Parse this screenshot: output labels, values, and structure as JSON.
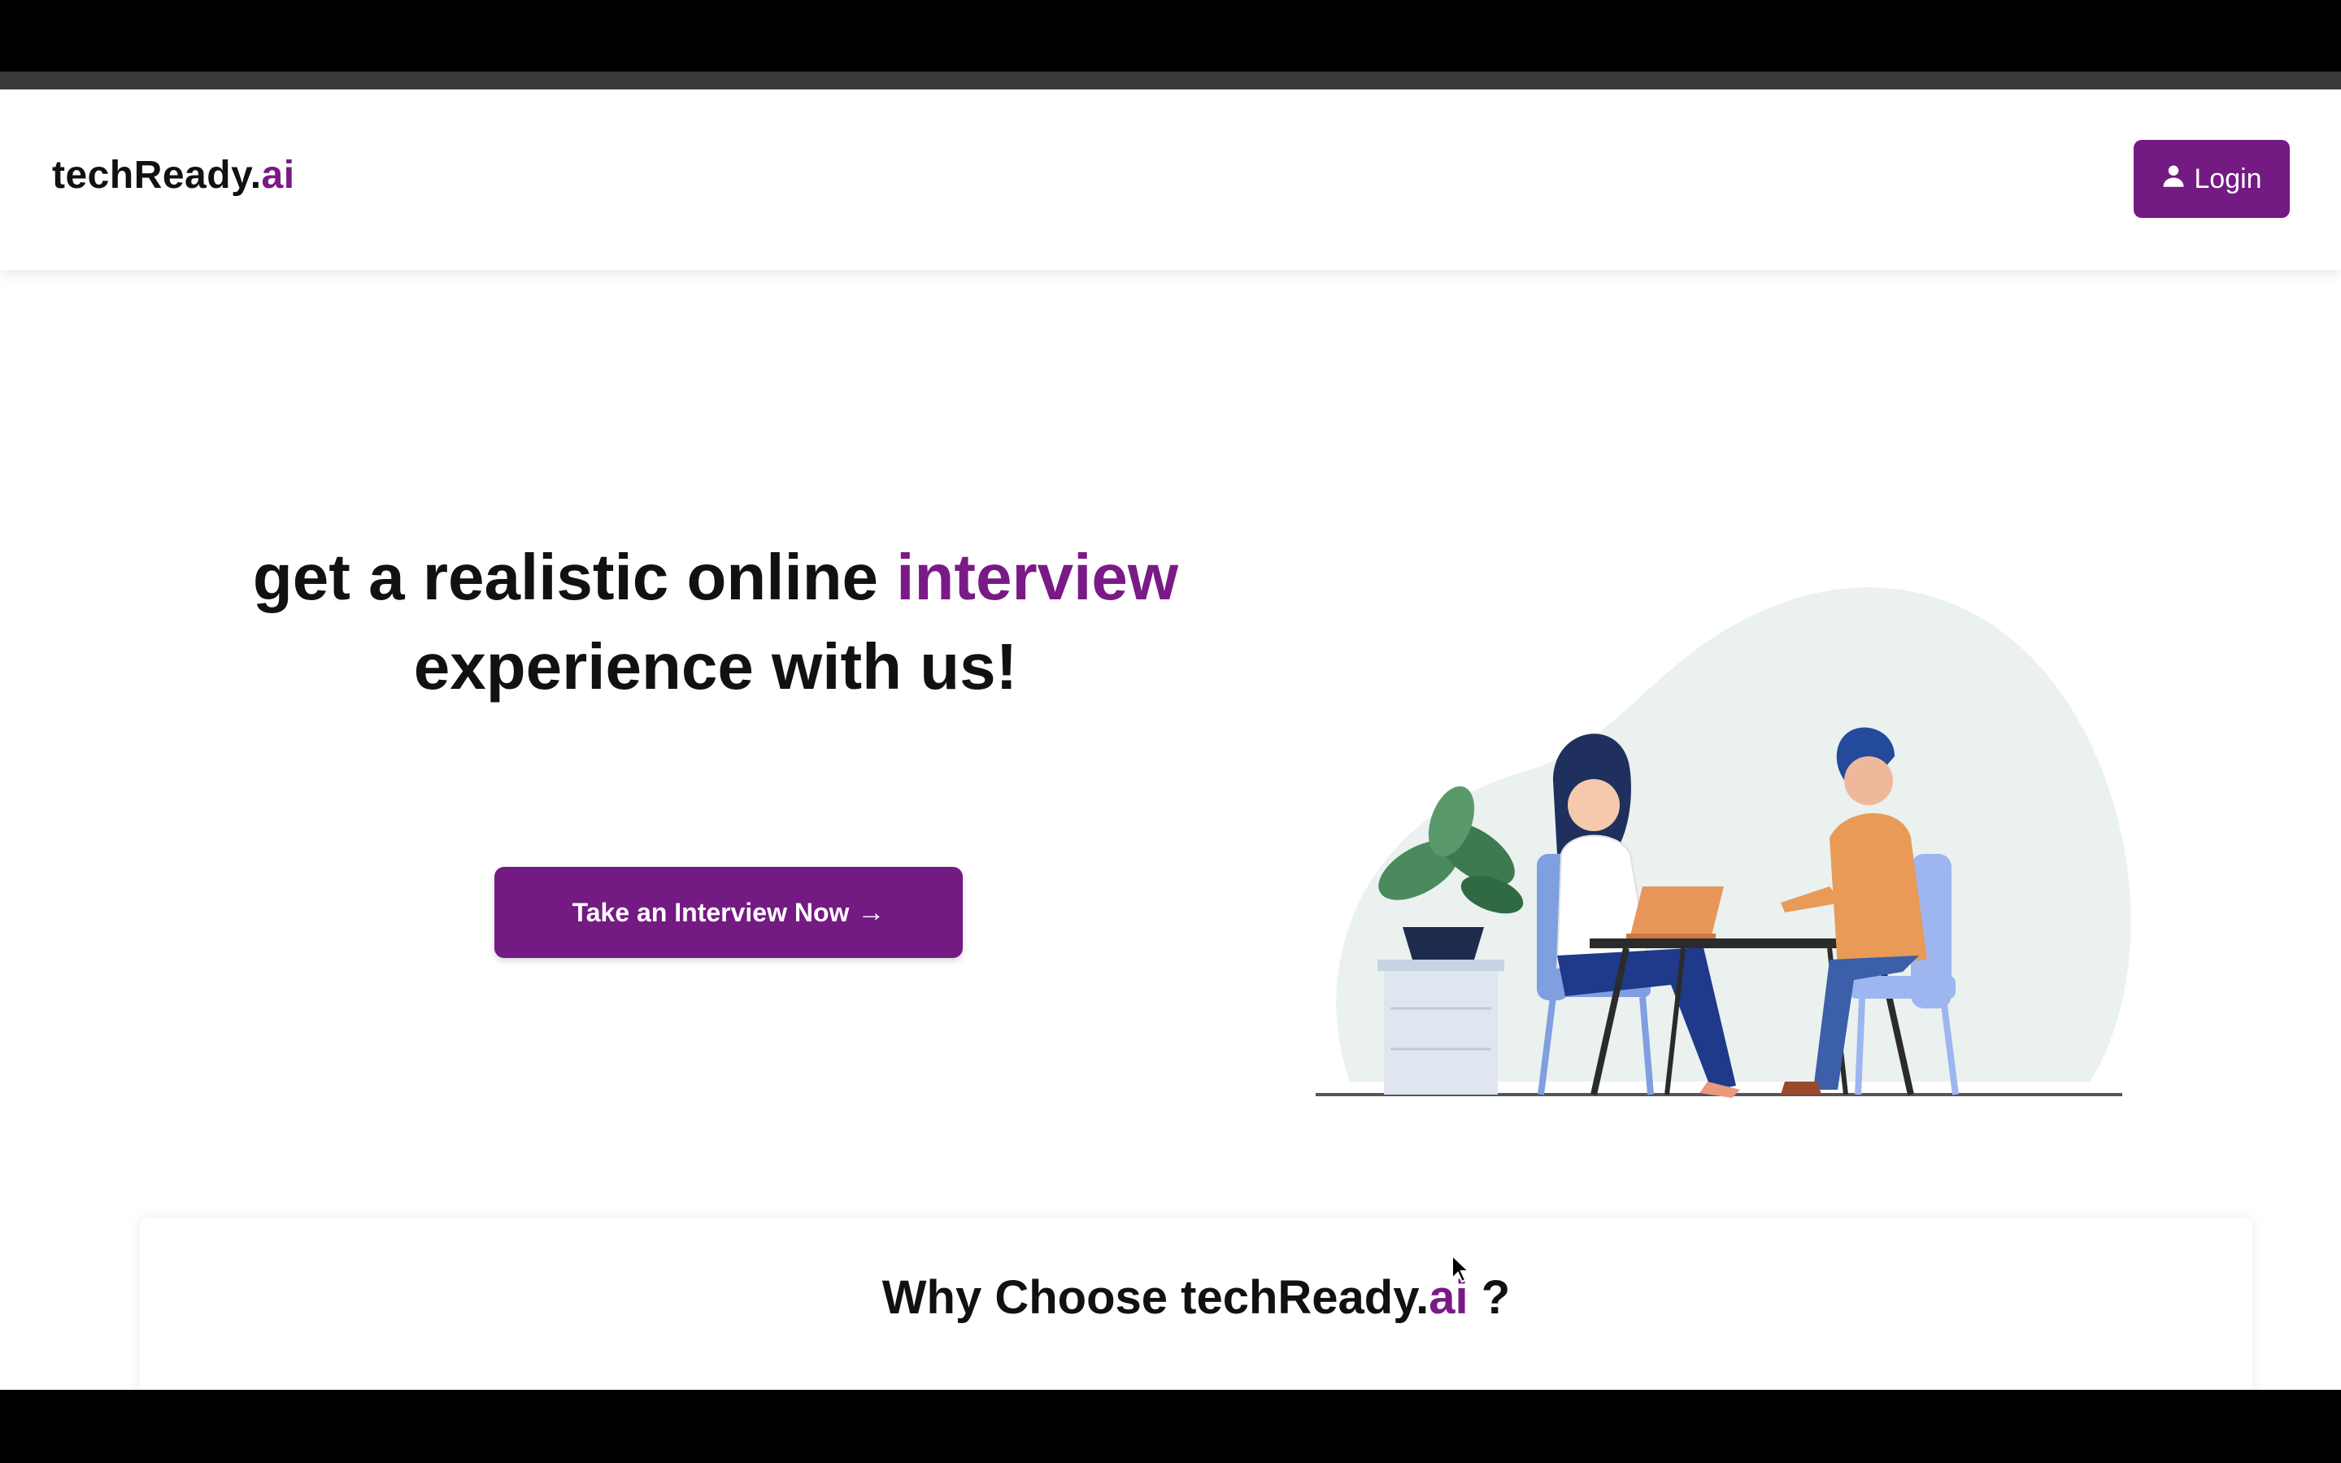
{
  "brand": {
    "name": "techReady.",
    "accent": "ai"
  },
  "nav": {
    "login_label": "Login",
    "login_icon": "user-icon"
  },
  "hero": {
    "title_part1": "get a realistic online ",
    "title_accent": "interview",
    "title_part2": "experience with us!",
    "cta_label": "Take an Interview Now",
    "cta_icon": "arrow-right-icon",
    "illustration": "two-people-interview-illustration"
  },
  "why": {
    "title_part1": "Why Choose techReady.",
    "title_accent": "ai",
    "title_part2": " ?"
  },
  "colors": {
    "accent": "#741a83",
    "text": "#111111",
    "background": "#ffffff"
  }
}
